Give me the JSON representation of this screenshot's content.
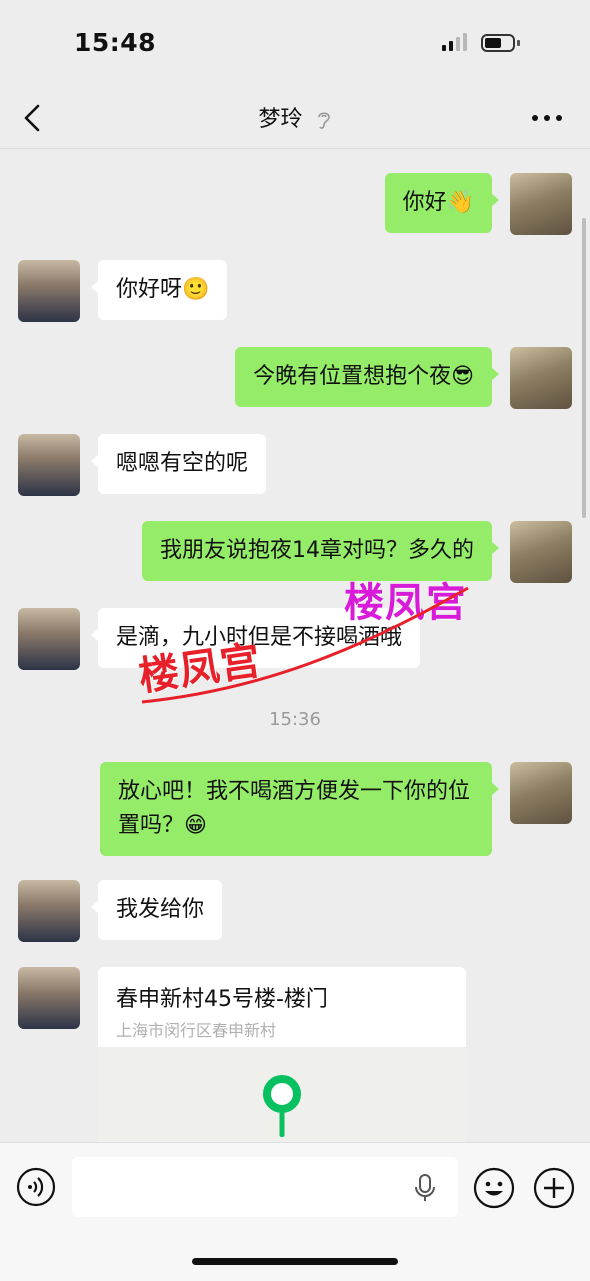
{
  "status": {
    "time": "15:48"
  },
  "header": {
    "title": "梦玲",
    "back_icon": "chevron-left-icon",
    "more_icon": "ellipsis-icon",
    "mute_icon": "ear-off-icon"
  },
  "messages": [
    {
      "from": "me",
      "text": "你好👋"
    },
    {
      "from": "her",
      "text": "你好呀🙂"
    },
    {
      "from": "me",
      "text": "今晚有位置想抱个夜😎"
    },
    {
      "from": "her",
      "text": "嗯嗯有空的呢"
    },
    {
      "from": "me",
      "text": "我朋友说抱夜14章对吗？多久的"
    },
    {
      "from": "her",
      "text": "是滴，九小时但是不接喝酒哦"
    },
    {
      "timestamp": "15:36"
    },
    {
      "from": "me",
      "text": "放心吧！我不喝酒方便发一下你的位置吗？😁"
    },
    {
      "from": "her",
      "text": "我发给你"
    }
  ],
  "location": {
    "title": "春申新村45号楼-楼门",
    "address": "上海市闵行区春申新村"
  },
  "watermark": {
    "text": "楼凤宫"
  },
  "input_bar": {
    "placeholder": ""
  },
  "colors": {
    "my_bubble": "#95ec69",
    "her_bubble": "#ffffff",
    "background": "#ededed",
    "pin": "#07c160"
  }
}
